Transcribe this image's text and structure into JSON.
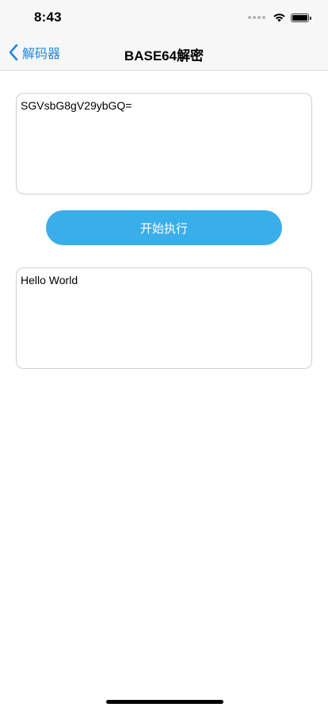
{
  "status_bar": {
    "time": "8:43"
  },
  "nav": {
    "back_label": "解码器",
    "title": "BASE64解密"
  },
  "input": {
    "value": "SGVsbG8gV29ybGQ="
  },
  "action": {
    "run_label": "开始执行"
  },
  "output": {
    "value": "Hello World"
  },
  "colors": {
    "accent": "#1e88e5",
    "button": "#3aaee9"
  }
}
